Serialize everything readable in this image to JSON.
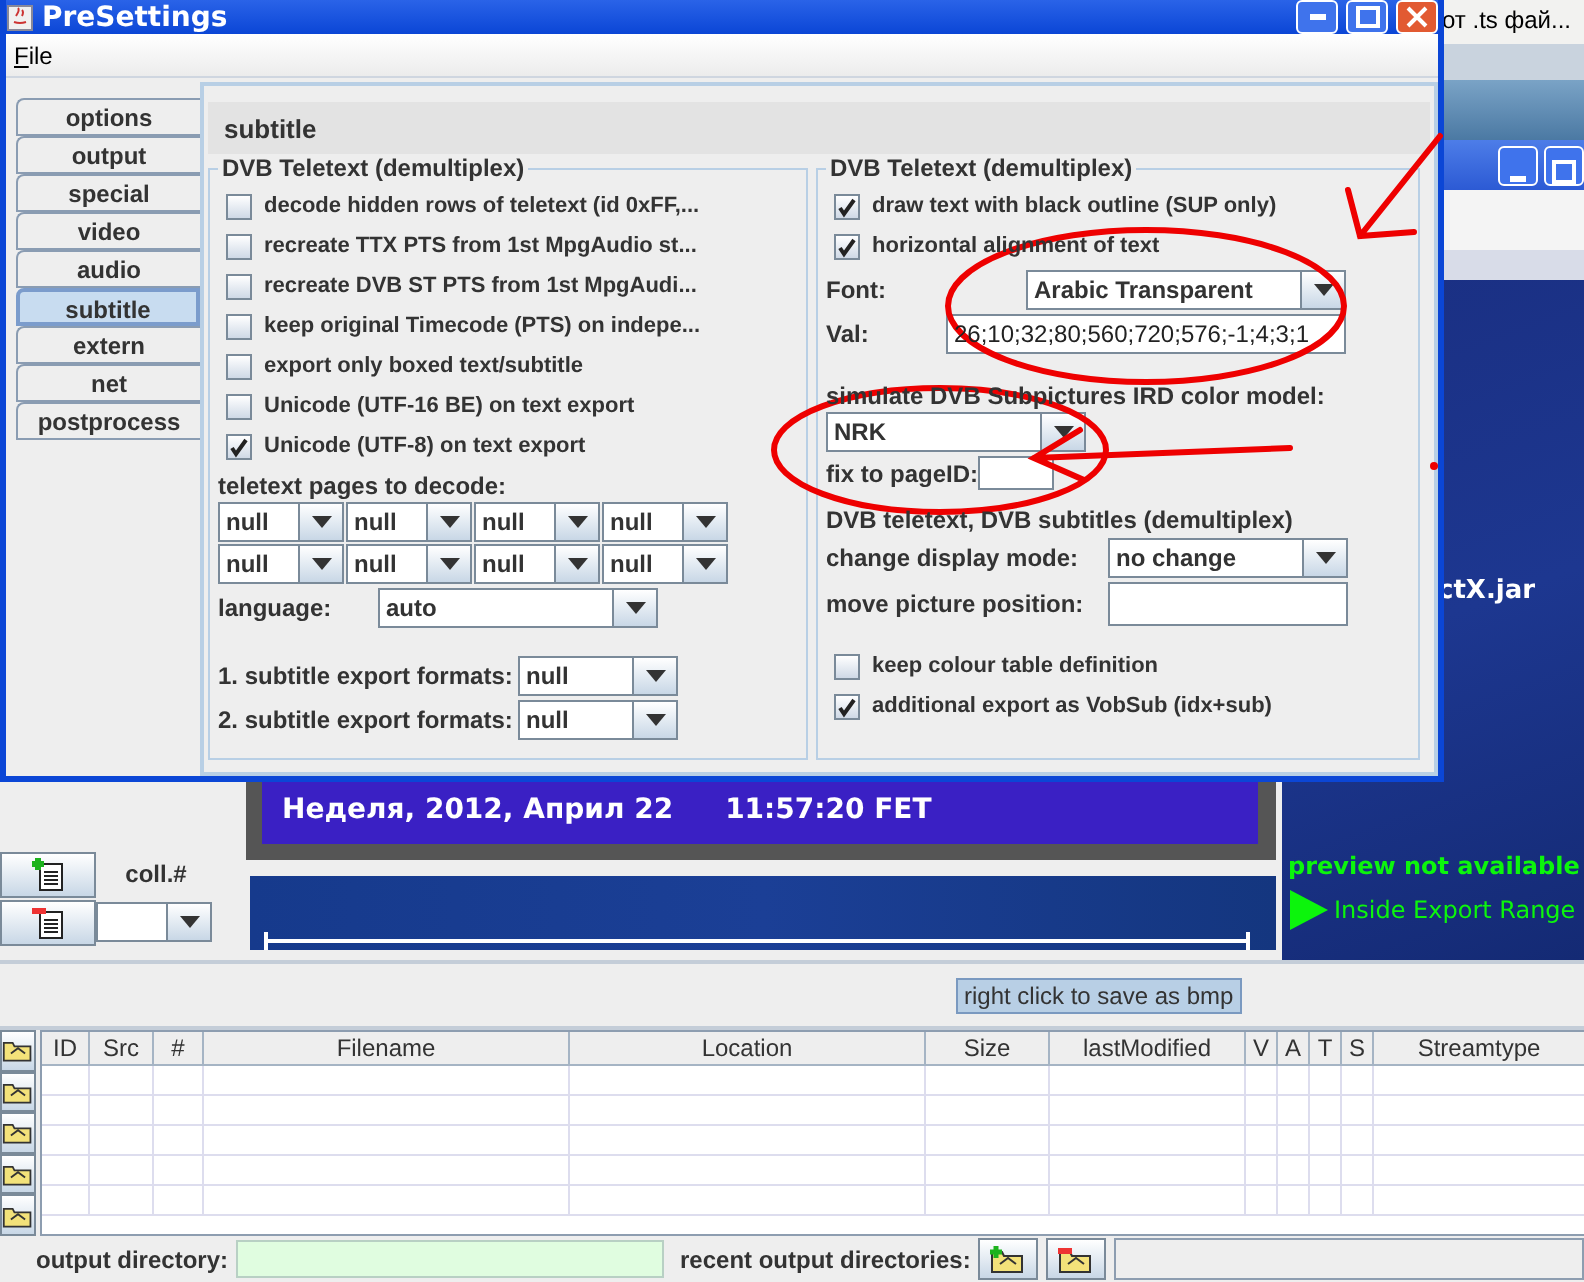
{
  "background_window": {
    "other_window_title": "от .ts фай...",
    "file_label": "ctX.jar",
    "collection_label": "coll.#",
    "video_caption": "Неделя, 2012, Април 22",
    "video_time": "11:57:20 FET",
    "preview_status": "preview not available",
    "export_range": "Inside Export Range",
    "save_hint": "right click to save as bmp",
    "table": {
      "columns": [
        "ID",
        "Src",
        "#",
        "Filename",
        "Location",
        "Size",
        "lastModified",
        "V",
        "A",
        "T",
        "S",
        "Streamtype"
      ]
    },
    "output_directory_label": "output directory:",
    "recent_directories_label": "recent output directories:"
  },
  "dialog": {
    "title": "PreSettings",
    "menu": [
      "File"
    ],
    "tabs": [
      {
        "label": "options",
        "selected": false
      },
      {
        "label": "output",
        "selected": false
      },
      {
        "label": "special",
        "selected": false
      },
      {
        "label": "video",
        "selected": false
      },
      {
        "label": "audio",
        "selected": false
      },
      {
        "label": "subtitle",
        "selected": true
      },
      {
        "label": "extern",
        "selected": false
      },
      {
        "label": "net",
        "selected": false
      },
      {
        "label": "postprocess",
        "selected": false
      }
    ],
    "panel_title": "subtitle",
    "left_group": {
      "title": "DVB Teletext (demultiplex)",
      "options": [
        {
          "label": "decode hidden rows of teletext (id 0xFF,...",
          "checked": false
        },
        {
          "label": "recreate TTX PTS from 1st MpgAudio st...",
          "checked": false
        },
        {
          "label": "recreate DVB ST PTS from 1st MpgAudi...",
          "checked": false
        },
        {
          "label": "keep original Timecode (PTS) on indepe...",
          "checked": false
        },
        {
          "label": "export only boxed text/subtitle",
          "checked": false
        },
        {
          "label": "Unicode (UTF-16 BE) on text export",
          "checked": false
        },
        {
          "label": "Unicode (UTF-8) on text export",
          "checked": true
        }
      ],
      "pages_label": "teletext pages to decode:",
      "pages": [
        "null",
        "null",
        "null",
        "null",
        "null",
        "null",
        "null",
        "null"
      ],
      "language_label": "language:",
      "language": "auto",
      "export_formats": [
        {
          "label": "1. subtitle export formats:",
          "value": "null"
        },
        {
          "label": "2. subtitle export formats:",
          "value": "null"
        }
      ]
    },
    "right_group": {
      "title": "DVB Teletext (demultiplex)",
      "options": [
        {
          "label": "draw text with black outline (SUP only)",
          "checked": true
        },
        {
          "label": "horizontal alignment of text",
          "checked": true
        }
      ],
      "font_label": "Font:",
      "font": "Arabic Transparent",
      "val_label": "Val:",
      "val": "26;10;32;80;560;720;576;-1;4;3;1",
      "color_model_label": "simulate DVB Subpictures IRD color model:",
      "color_model": "NRK",
      "page_id_label": "fix to pageID:",
      "subtitles_title": "DVB teletext, DVB subtitles (demultiplex)",
      "display_mode_label": "change display mode:",
      "display_mode": "no change",
      "move_position_label": "move picture position:",
      "options_2": [
        {
          "label": "keep colour table definition",
          "checked": false
        },
        {
          "label": "additional export as VobSub (idx+sub)",
          "checked": true
        }
      ]
    }
  }
}
